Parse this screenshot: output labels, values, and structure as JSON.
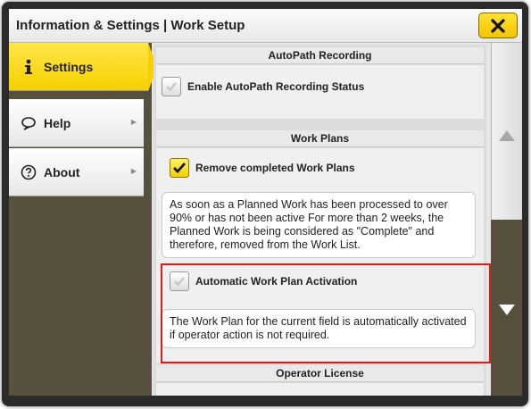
{
  "window": {
    "title": "Information & Settings | Work Setup"
  },
  "sidebar": {
    "items": [
      {
        "label": "Settings",
        "icon": "person-info-icon",
        "active": true
      },
      {
        "label": "Help",
        "icon": "speech-bubble-icon",
        "active": false
      },
      {
        "label": "About",
        "icon": "question-circle-icon",
        "active": false
      }
    ]
  },
  "sections": {
    "autopath": {
      "header": "AutoPath Recording",
      "checkbox_label": "Enable AutoPath Recording Status",
      "checked": false
    },
    "work_plans": {
      "header": "Work Plans",
      "remove_label": "Remove completed Work Plans",
      "remove_checked": true,
      "remove_desc": "As soon as a Planned Work has been processed to over 90% or has not been active For more than 2 weeks, the Planned Work is being considered as \"Complete\" and therefore, removed from the Work List.",
      "activation_label": "Automatic Work Plan Activation",
      "activation_checked": false,
      "activation_desc": "The Work Plan for the current field is automatically activated if operator action is not required."
    },
    "operator_license": {
      "header": "Operator License"
    }
  },
  "colors": {
    "accent_yellow": "#f7d000",
    "sidebar_bg": "#57503c",
    "highlight_red": "#e01b1b"
  }
}
